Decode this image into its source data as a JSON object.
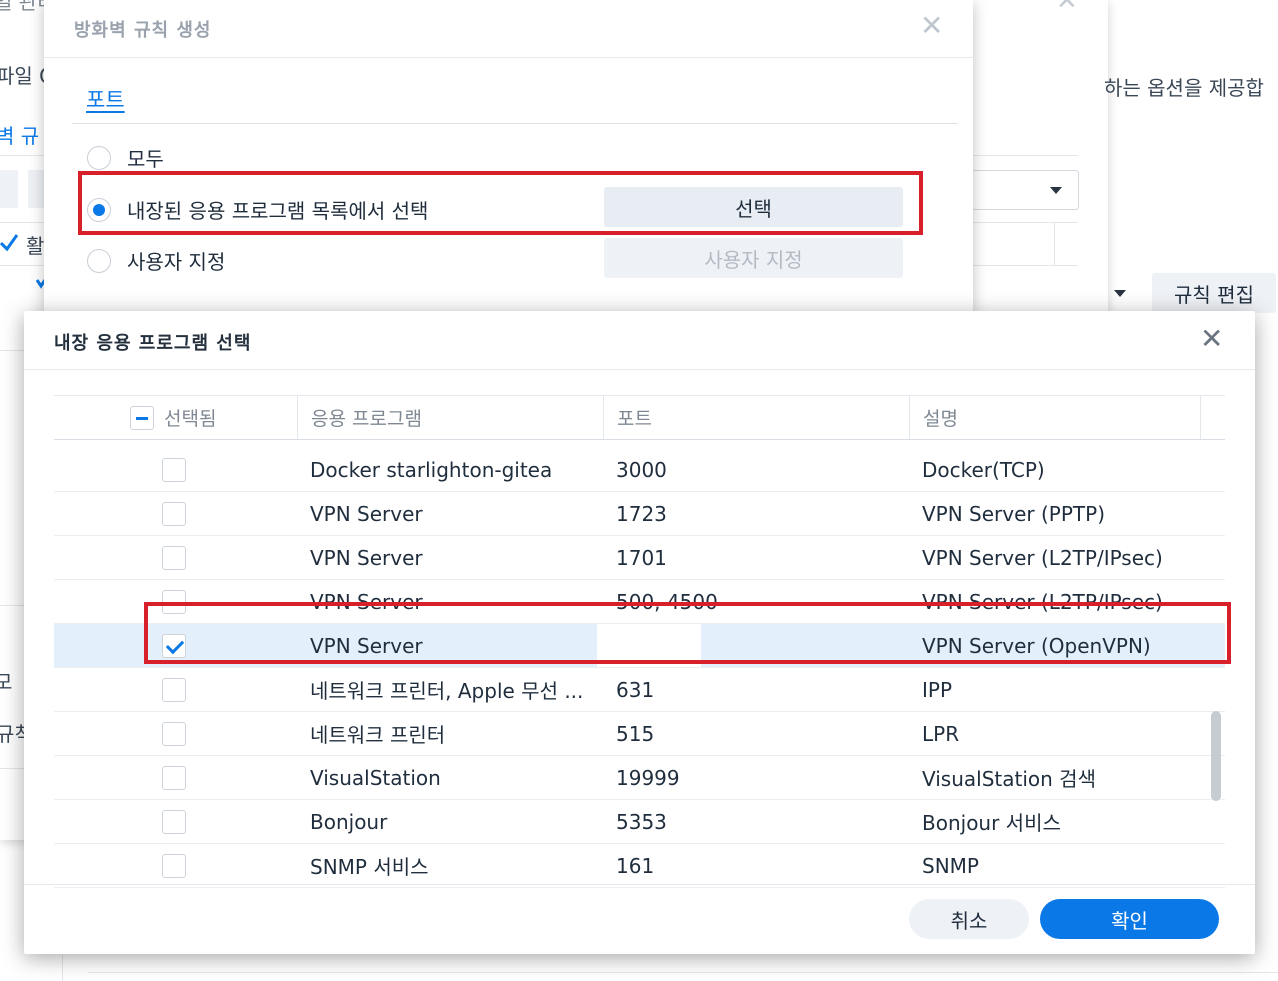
{
  "background": {
    "frag_title": "일 관리",
    "frag_file": "파일 O",
    "frag_rules": "벽 규",
    "frag_check": "활",
    "frag_desc": "하는 옵션을 제공합",
    "edit_rules_button": "규칙 편집",
    "frag_mode": "모",
    "frag_rule": "규칙"
  },
  "create_rule_dialog": {
    "title": "방화벽 규칙 생성",
    "tab_ports": "포트",
    "options": [
      {
        "label": "모두",
        "selected": false
      },
      {
        "label": "내장된 응용 프로그램 목록에서 선택",
        "selected": true
      },
      {
        "label": "사용자 지정",
        "selected": false
      }
    ],
    "select_button": "선택",
    "custom_button": "사용자 지정"
  },
  "app_select_dialog": {
    "title": "내장 응용 프로그램 선택",
    "columns": {
      "selected": "선택됨",
      "application": "응용 프로그램",
      "port": "포트",
      "description": "설명"
    },
    "rows": [
      {
        "checked": false,
        "app": "Docker starlighton-gitea",
        "port": "3000",
        "desc": "Docker(TCP)"
      },
      {
        "checked": false,
        "app": "VPN Server",
        "port": "1723",
        "desc": "VPN Server (PPTP)"
      },
      {
        "checked": false,
        "app": "VPN Server",
        "port": "1701",
        "desc": "VPN Server (L2TP/IPsec)"
      },
      {
        "checked": false,
        "app": "VPN Server",
        "port": "500, 4500",
        "desc": "VPN Server (L2TP/IPsec)"
      },
      {
        "checked": true,
        "app": "VPN Server",
        "port": "",
        "desc": "VPN Server (OpenVPN)"
      },
      {
        "checked": false,
        "app": "네트워크 프린터, Apple 무선 ...",
        "port": "631",
        "desc": "IPP"
      },
      {
        "checked": false,
        "app": "네트워크 프린터",
        "port": "515",
        "desc": "LPR"
      },
      {
        "checked": false,
        "app": "VisualStation",
        "port": "19999",
        "desc": "VisualStation 검색"
      },
      {
        "checked": false,
        "app": "Bonjour",
        "port": "5353",
        "desc": "Bonjour 서비스"
      },
      {
        "checked": false,
        "app": "SNMP 서비스",
        "port": "161",
        "desc": "SNMP"
      }
    ],
    "cancel_button": "취소",
    "ok_button": "확인"
  },
  "colors": {
    "accent": "#0a78e6",
    "highlight": "#d8202a",
    "selected_row": "#e3effb"
  }
}
